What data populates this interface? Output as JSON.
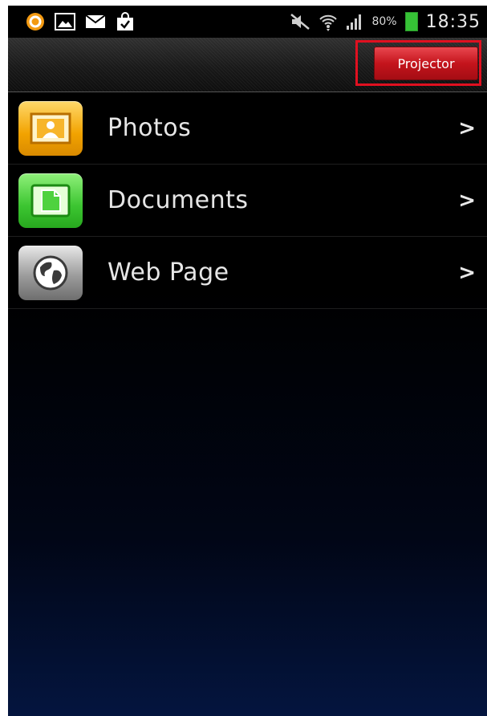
{
  "status_bar": {
    "battery_percent": "80%",
    "time": "18:35",
    "left_icons": [
      "app-notification-icon",
      "image-icon",
      "mail-icon",
      "shopping-bag-icon"
    ],
    "right_icons": [
      "mute-icon",
      "wifi-icon",
      "signal-icon",
      "battery-icon"
    ]
  },
  "action_bar": {
    "projector_label": "Projector",
    "highlight_color": "#e01020"
  },
  "list": {
    "items": [
      {
        "label": "Photos",
        "icon": "photos-icon",
        "chevron": ">"
      },
      {
        "label": "Documents",
        "icon": "documents-icon",
        "chevron": ">"
      },
      {
        "label": "Web Page",
        "icon": "web-page-icon",
        "chevron": ">"
      }
    ]
  }
}
